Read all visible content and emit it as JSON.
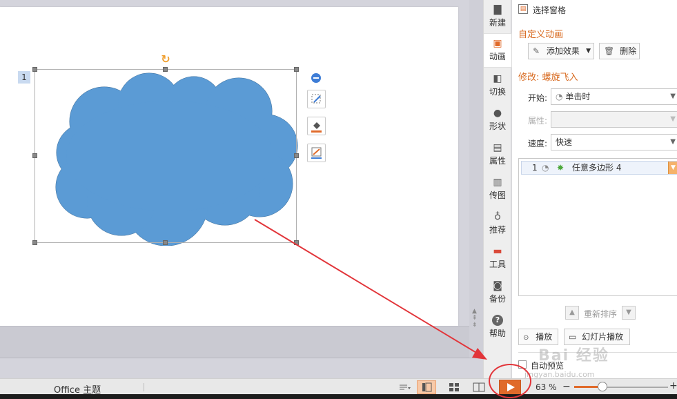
{
  "slide": {
    "animation_badge": "1"
  },
  "sidebar_tabs": [
    {
      "label": "新建",
      "icon": "new-file-icon"
    },
    {
      "label": "动画",
      "icon": "animation-icon"
    },
    {
      "label": "切换",
      "icon": "transition-icon"
    },
    {
      "label": "形状",
      "icon": "shape-icon"
    },
    {
      "label": "属性",
      "icon": "properties-icon"
    },
    {
      "label": "传图",
      "icon": "upload-image-icon"
    },
    {
      "label": "推荐",
      "icon": "recommend-icon"
    },
    {
      "label": "工具",
      "icon": "toolbox-icon"
    },
    {
      "label": "备份",
      "icon": "backup-icon"
    },
    {
      "label": "帮助",
      "icon": "help-icon"
    }
  ],
  "task_pane": {
    "selection_pane_label": "选择窗格",
    "custom_animation_title": "自定义动画",
    "add_effect_label": "添加效果",
    "delete_label": "删除",
    "modify_title": "修改: 螺旋飞入",
    "start_label": "开始:",
    "start_value": "单击时",
    "property_label": "属性:",
    "speed_label": "速度:",
    "speed_value": "快速",
    "effect_items": [
      {
        "index": "1",
        "name": "任意多边形 4"
      }
    ],
    "reorder_label": "重新排序",
    "play_label": "播放",
    "slideshow_label": "幻灯片播放",
    "auto_preview_label": "自动预览"
  },
  "status_bar": {
    "theme": "Office 主题",
    "zoom": "63 %",
    "zoom_fraction": 0.3
  },
  "colors": {
    "cloud_fill": "#5b9bd5",
    "cloud_stroke": "#41719c",
    "accent": "#d86b21",
    "annotation": "#e2353a"
  },
  "watermark": {
    "text": "Bai 经验",
    "sub": "jingyan.baidu.com"
  }
}
